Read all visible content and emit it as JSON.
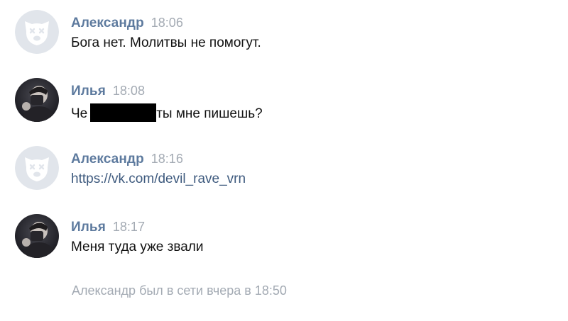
{
  "messages": [
    {
      "author": "Александр",
      "time": "18:06",
      "text": "Бога нет. Молитвы не помогут.",
      "avatar": "deactivated-dog-icon"
    },
    {
      "author": "Илья",
      "time": "18:08",
      "text_before": "Че",
      "text_after": "ты мне пишешь?",
      "has_redaction": true,
      "avatar": "user-photo"
    },
    {
      "author": "Александр",
      "time": "18:16",
      "text": "https://vk.com/devil_rave_vrn",
      "is_link": true,
      "avatar": "deactivated-dog-icon"
    },
    {
      "author": "Илья",
      "time": "18:17",
      "text": "Меня туда уже звали",
      "avatar": "user-photo"
    }
  ],
  "status": "Александр был в сети вчера в 18:50",
  "colors": {
    "author": "#5d7a9e",
    "time": "#a3aab3",
    "text": "#111111",
    "link": "#3e5a7e",
    "avatar_placeholder": "#e1e5eb"
  }
}
